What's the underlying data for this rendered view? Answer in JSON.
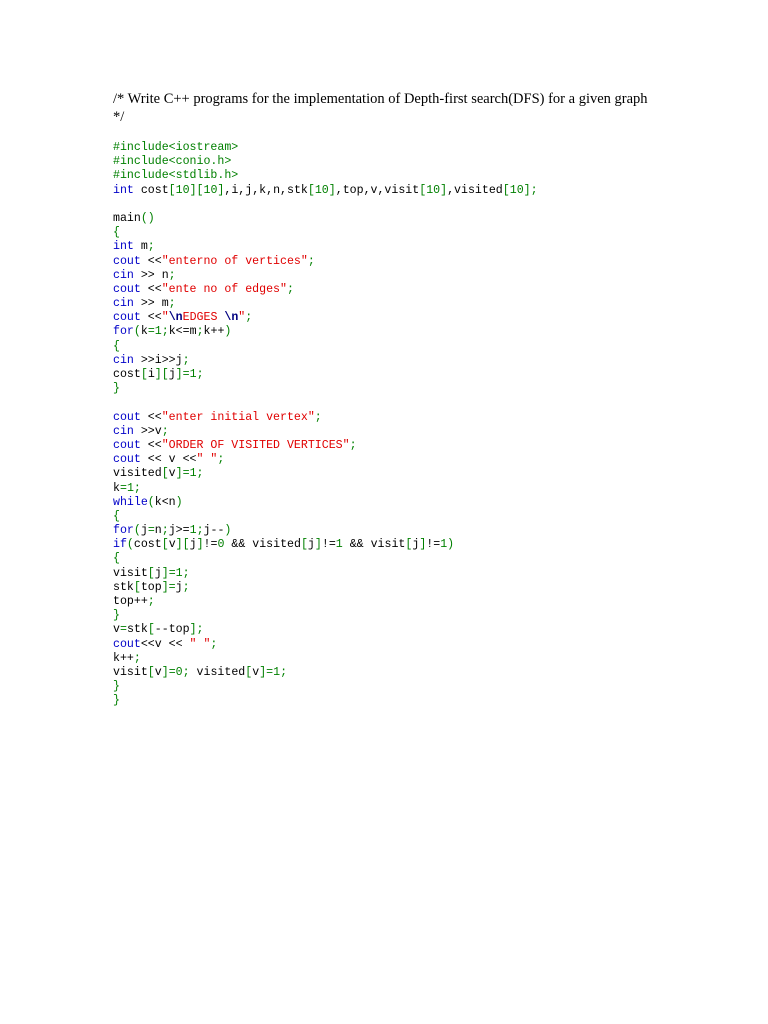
{
  "document": {
    "heading": "/* Write C++ programs for the implementation of Depth-first search(DFS) for a given graph */",
    "code_lines": [
      [
        [
          "pp",
          "#include<iostream>"
        ]
      ],
      [
        [
          "pp",
          "#include<conio.h>"
        ]
      ],
      [
        [
          "pp",
          "#include<stdlib.h>"
        ]
      ],
      [
        [
          "kw",
          "int"
        ],
        [
          "plain",
          " cost"
        ],
        [
          "punc",
          "["
        ],
        [
          "num",
          "10"
        ],
        [
          "punc",
          "]["
        ],
        [
          "num",
          "10"
        ],
        [
          "punc",
          "]"
        ],
        [
          "plain",
          ",i,j,k,n,stk"
        ],
        [
          "punc",
          "["
        ],
        [
          "num",
          "10"
        ],
        [
          "punc",
          "]"
        ],
        [
          "plain",
          ",top,v,visit"
        ],
        [
          "punc",
          "["
        ],
        [
          "num",
          "10"
        ],
        [
          "punc",
          "]"
        ],
        [
          "plain",
          ",visited"
        ],
        [
          "punc",
          "["
        ],
        [
          "num",
          "10"
        ],
        [
          "punc",
          "]"
        ],
        [
          "punc",
          ";"
        ]
      ],
      [],
      [
        [
          "plain",
          "main"
        ],
        [
          "punc",
          "()"
        ]
      ],
      [
        [
          "punc",
          "{"
        ]
      ],
      [
        [
          "kw",
          "int"
        ],
        [
          "plain",
          " m"
        ],
        [
          "punc",
          ";"
        ]
      ],
      [
        [
          "kw",
          "cout"
        ],
        [
          "plain",
          " <<"
        ],
        [
          "str",
          "\"enterno of vertices\""
        ],
        [
          "punc",
          ";"
        ]
      ],
      [
        [
          "kw",
          "cin"
        ],
        [
          "plain",
          " >> n"
        ],
        [
          "punc",
          ";"
        ]
      ],
      [
        [
          "kw",
          "cout"
        ],
        [
          "plain",
          " <<"
        ],
        [
          "str",
          "\"ente no of edges\""
        ],
        [
          "punc",
          ";"
        ]
      ],
      [
        [
          "kw",
          "cin"
        ],
        [
          "plain",
          " >> m"
        ],
        [
          "punc",
          ";"
        ]
      ],
      [
        [
          "kw",
          "cout"
        ],
        [
          "plain",
          " <<"
        ],
        [
          "str",
          "\""
        ],
        [
          "esc",
          "\\n"
        ],
        [
          "str",
          "EDGES "
        ],
        [
          "esc",
          "\\n"
        ],
        [
          "str",
          "\""
        ],
        [
          "punc",
          ";"
        ]
      ],
      [
        [
          "kw",
          "for"
        ],
        [
          "punc",
          "("
        ],
        [
          "plain",
          "k"
        ],
        [
          "punc",
          "="
        ],
        [
          "num",
          "1"
        ],
        [
          "punc",
          ";"
        ],
        [
          "plain",
          "k<=m"
        ],
        [
          "punc",
          ";"
        ],
        [
          "plain",
          "k++"
        ],
        [
          "punc",
          ")"
        ]
      ],
      [
        [
          "punc",
          "{"
        ]
      ],
      [
        [
          "kw",
          "cin"
        ],
        [
          "plain",
          " >>i>>j"
        ],
        [
          "punc",
          ";"
        ]
      ],
      [
        [
          "plain",
          "cost"
        ],
        [
          "punc",
          "["
        ],
        [
          "plain",
          "i"
        ],
        [
          "punc",
          "]["
        ],
        [
          "plain",
          "j"
        ],
        [
          "punc",
          "]="
        ],
        [
          "num",
          "1"
        ],
        [
          "punc",
          ";"
        ]
      ],
      [
        [
          "punc",
          "}"
        ]
      ],
      [],
      [
        [
          "kw",
          "cout"
        ],
        [
          "plain",
          " <<"
        ],
        [
          "str",
          "\"enter initial vertex\""
        ],
        [
          "punc",
          ";"
        ]
      ],
      [
        [
          "kw",
          "cin"
        ],
        [
          "plain",
          " >>v"
        ],
        [
          "punc",
          ";"
        ]
      ],
      [
        [
          "kw",
          "cout"
        ],
        [
          "plain",
          " <<"
        ],
        [
          "str",
          "\"ORDER OF VISITED VERTICES\""
        ],
        [
          "punc",
          ";"
        ]
      ],
      [
        [
          "kw",
          "cout"
        ],
        [
          "plain",
          " << v <<"
        ],
        [
          "str",
          "\" \""
        ],
        [
          "punc",
          ";"
        ]
      ],
      [
        [
          "plain",
          "visited"
        ],
        [
          "punc",
          "["
        ],
        [
          "plain",
          "v"
        ],
        [
          "punc",
          "]="
        ],
        [
          "num",
          "1"
        ],
        [
          "punc",
          ";"
        ]
      ],
      [
        [
          "plain",
          "k"
        ],
        [
          "punc",
          "="
        ],
        [
          "num",
          "1"
        ],
        [
          "punc",
          ";"
        ]
      ],
      [
        [
          "kw",
          "while"
        ],
        [
          "punc",
          "("
        ],
        [
          "plain",
          "k<n"
        ],
        [
          "punc",
          ")"
        ]
      ],
      [
        [
          "punc",
          "{"
        ]
      ],
      [
        [
          "kw",
          "for"
        ],
        [
          "punc",
          "("
        ],
        [
          "plain",
          "j"
        ],
        [
          "punc",
          "="
        ],
        [
          "plain",
          "n"
        ],
        [
          "punc",
          ";"
        ],
        [
          "plain",
          "j>="
        ],
        [
          "num",
          "1"
        ],
        [
          "punc",
          ";"
        ],
        [
          "plain",
          "j--"
        ],
        [
          "punc",
          ")"
        ]
      ],
      [
        [
          "kw",
          "if"
        ],
        [
          "punc",
          "("
        ],
        [
          "plain",
          "cost"
        ],
        [
          "punc",
          "["
        ],
        [
          "plain",
          "v"
        ],
        [
          "punc",
          "]["
        ],
        [
          "plain",
          "j"
        ],
        [
          "punc",
          "]"
        ],
        [
          "plain",
          "!="
        ],
        [
          "num",
          "0"
        ],
        [
          "plain",
          " && visited"
        ],
        [
          "punc",
          "["
        ],
        [
          "plain",
          "j"
        ],
        [
          "punc",
          "]"
        ],
        [
          "plain",
          "!="
        ],
        [
          "num",
          "1"
        ],
        [
          "plain",
          " && visit"
        ],
        [
          "punc",
          "["
        ],
        [
          "plain",
          "j"
        ],
        [
          "punc",
          "]"
        ],
        [
          "plain",
          "!="
        ],
        [
          "num",
          "1"
        ],
        [
          "punc",
          ")"
        ]
      ],
      [
        [
          "punc",
          "{"
        ]
      ],
      [
        [
          "plain",
          "visit"
        ],
        [
          "punc",
          "["
        ],
        [
          "plain",
          "j"
        ],
        [
          "punc",
          "]="
        ],
        [
          "num",
          "1"
        ],
        [
          "punc",
          ";"
        ]
      ],
      [
        [
          "plain",
          "stk"
        ],
        [
          "punc",
          "["
        ],
        [
          "plain",
          "top"
        ],
        [
          "punc",
          "]="
        ],
        [
          "plain",
          "j"
        ],
        [
          "punc",
          ";"
        ]
      ],
      [
        [
          "plain",
          "top++"
        ],
        [
          "punc",
          ";"
        ]
      ],
      [
        [
          "punc",
          "}"
        ]
      ],
      [
        [
          "plain",
          "v"
        ],
        [
          "punc",
          "="
        ],
        [
          "plain",
          "stk"
        ],
        [
          "punc",
          "["
        ],
        [
          "plain",
          "--top"
        ],
        [
          "punc",
          "]"
        ],
        [
          "punc",
          ";"
        ]
      ],
      [
        [
          "kw",
          "cout"
        ],
        [
          "plain",
          "<<v << "
        ],
        [
          "str",
          "\" \""
        ],
        [
          "punc",
          ";"
        ]
      ],
      [
        [
          "plain",
          "k++"
        ],
        [
          "punc",
          ";"
        ]
      ],
      [
        [
          "plain",
          "visit"
        ],
        [
          "punc",
          "["
        ],
        [
          "plain",
          "v"
        ],
        [
          "punc",
          "]="
        ],
        [
          "num",
          "0"
        ],
        [
          "punc",
          ";"
        ],
        [
          "plain",
          " visited"
        ],
        [
          "punc",
          "["
        ],
        [
          "plain",
          "v"
        ],
        [
          "punc",
          "]="
        ],
        [
          "num",
          "1"
        ],
        [
          "punc",
          ";"
        ]
      ],
      [
        [
          "punc",
          "}"
        ]
      ],
      [
        [
          "punc",
          "}"
        ]
      ]
    ]
  },
  "colors": {
    "keyword": "#0000c8",
    "string": "#e00000",
    "number": "#008000",
    "preprocessor": "#008000",
    "escape": "#000080",
    "text": "#000000",
    "background": "#ffffff"
  }
}
